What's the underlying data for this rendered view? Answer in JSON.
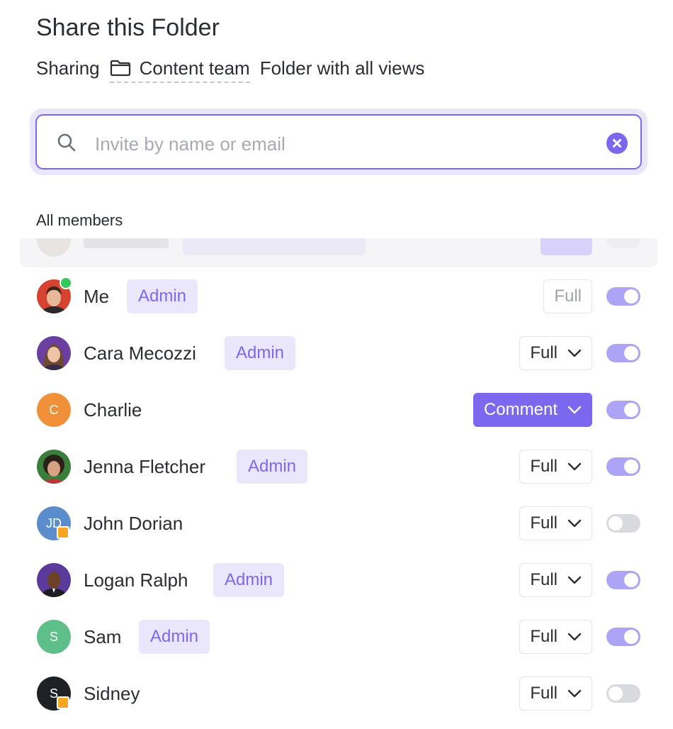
{
  "dialog": {
    "title": "Share this Folder",
    "sharing_prefix": "Sharing",
    "folder_name": "Content team",
    "sharing_suffix": "Folder with all views"
  },
  "search": {
    "placeholder": "Invite by name or email",
    "value": ""
  },
  "section_label": "All members",
  "members": [
    {
      "name": "Me",
      "badge": "Admin",
      "permission": "Full",
      "permission_state": "disabled",
      "enabled": true,
      "online": true
    },
    {
      "name": "Cara Mecozzi",
      "badge": "Admin",
      "permission": "Full",
      "enabled": true
    },
    {
      "name": "Charlie",
      "initials": "C",
      "avatar_color": "#f0913a",
      "badge": "",
      "permission": "Comment",
      "permission_state": "active",
      "enabled": true
    },
    {
      "name": "Jenna Fletcher",
      "badge": "Admin",
      "permission": "Full",
      "enabled": true
    },
    {
      "name": "John Dorian",
      "initials": "JD",
      "avatar_color": "#5b8ccc",
      "badge": "",
      "permission": "Full",
      "enabled": false,
      "guest": true
    },
    {
      "name": "Logan Ralph",
      "badge": "Admin",
      "permission": "Full",
      "enabled": true
    },
    {
      "name": "Sam",
      "initials": "S",
      "avatar_color": "#5fbf8a",
      "badge": "Admin",
      "permission": "Full",
      "enabled": true
    },
    {
      "name": "Sidney",
      "initials": "S",
      "avatar_color": "#1e2126",
      "badge": "",
      "permission": "Full",
      "enabled": false,
      "guest": true
    }
  ],
  "colors": {
    "accent": "#7b68ee",
    "badge_bg": "#eae7fd",
    "toggle_on": "#aea4f5",
    "toggle_off": "#d9dadf",
    "guest": "#f5a623",
    "online": "#34c759"
  },
  "icons": {
    "folder": "folder-icon",
    "search": "search-icon",
    "clear": "clear-icon",
    "chevron": "chevron-down-icon"
  }
}
